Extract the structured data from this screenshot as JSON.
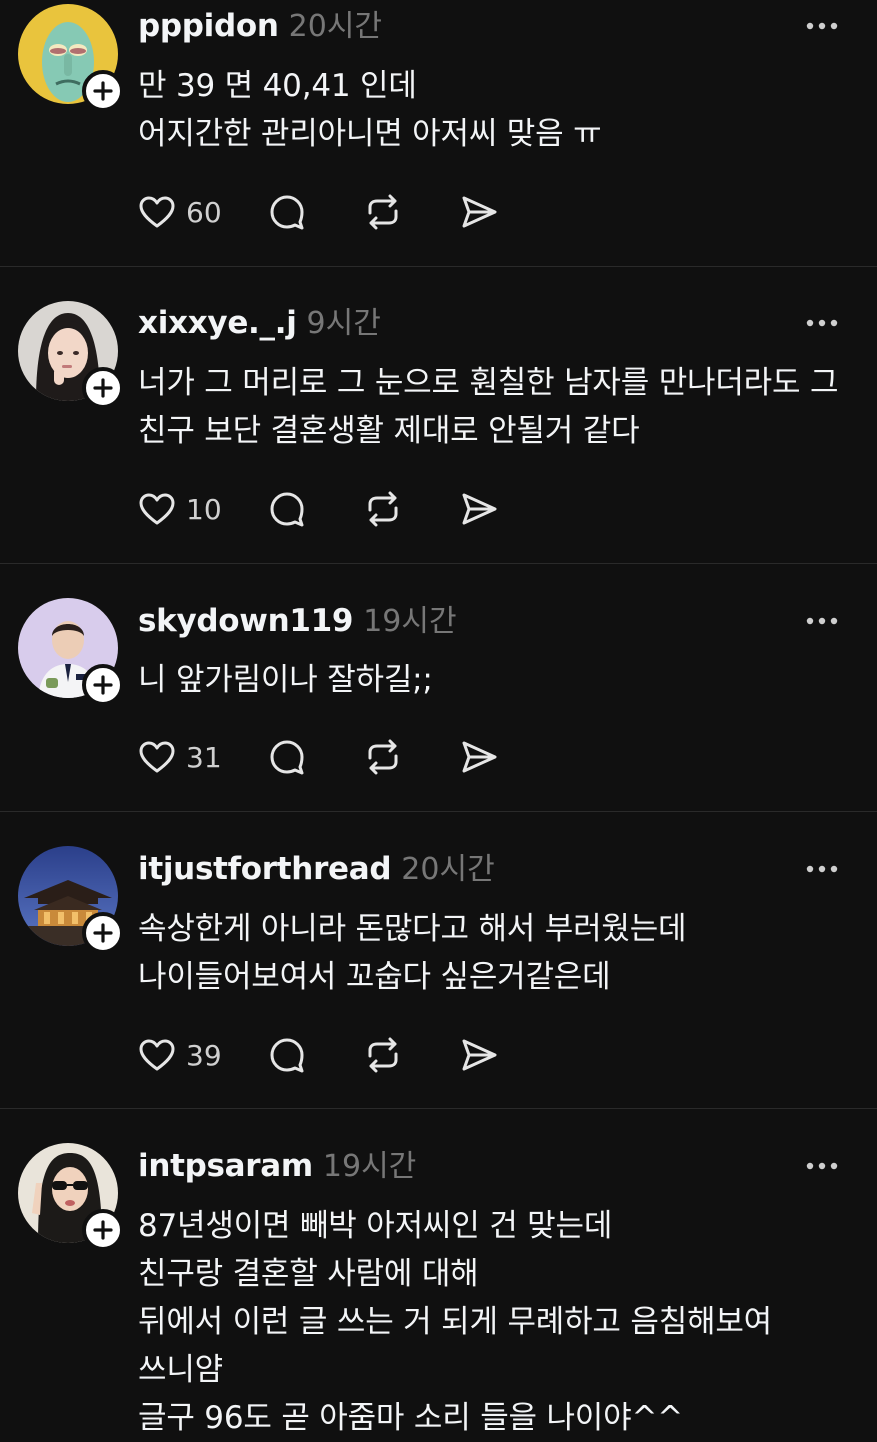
{
  "posts": [
    {
      "username": "pppidon",
      "timestamp": "20시간",
      "lines": [
        "만 39 면 40,41 인데",
        "어지간한 관리아니면 아저씨 맞음 ㅠ"
      ],
      "likes": "60"
    },
    {
      "username": "xixxye._.j",
      "timestamp": "9시간",
      "lines": [
        "너가 그 머리로 그 눈으로 훤칠한 남자를 만나더라도 그",
        "친구 보단 결혼생활 제대로 안될거 같다"
      ],
      "likes": "10"
    },
    {
      "username": "skydown119",
      "timestamp": "19시간",
      "lines": [
        "니 앞가림이나 잘하길;;"
      ],
      "likes": "31"
    },
    {
      "username": "itjustforthread",
      "timestamp": "20시간",
      "lines": [
        "속상한게 아니라 돈많다고 해서 부러웠는데",
        "나이들어보여서 꼬숩다 싶은거같은데"
      ],
      "likes": "39"
    },
    {
      "username": "intpsaram",
      "timestamp": "19시간",
      "lines": [
        "87년생이면 빼박 아저씨인 건 맞는데",
        "친구랑 결혼할 사람에 대해",
        "뒤에서 이런 글 쓰는 거 되게 무례하고 음침해보여",
        "쓰니얌",
        "글구 96도 곧 아줌마 소리 들을 나이야^^"
      ],
      "likes": ""
    }
  ],
  "icons": {
    "like": "heart-icon",
    "reply": "comment-bubble-icon",
    "repost": "repost-icon",
    "share": "send-icon",
    "more": "more-dots-icon",
    "follow": "plus-icon"
  },
  "colors": {
    "background": "#101010",
    "text": "#f3f5f7",
    "muted": "#777777",
    "divider": "#2a2a2a"
  }
}
